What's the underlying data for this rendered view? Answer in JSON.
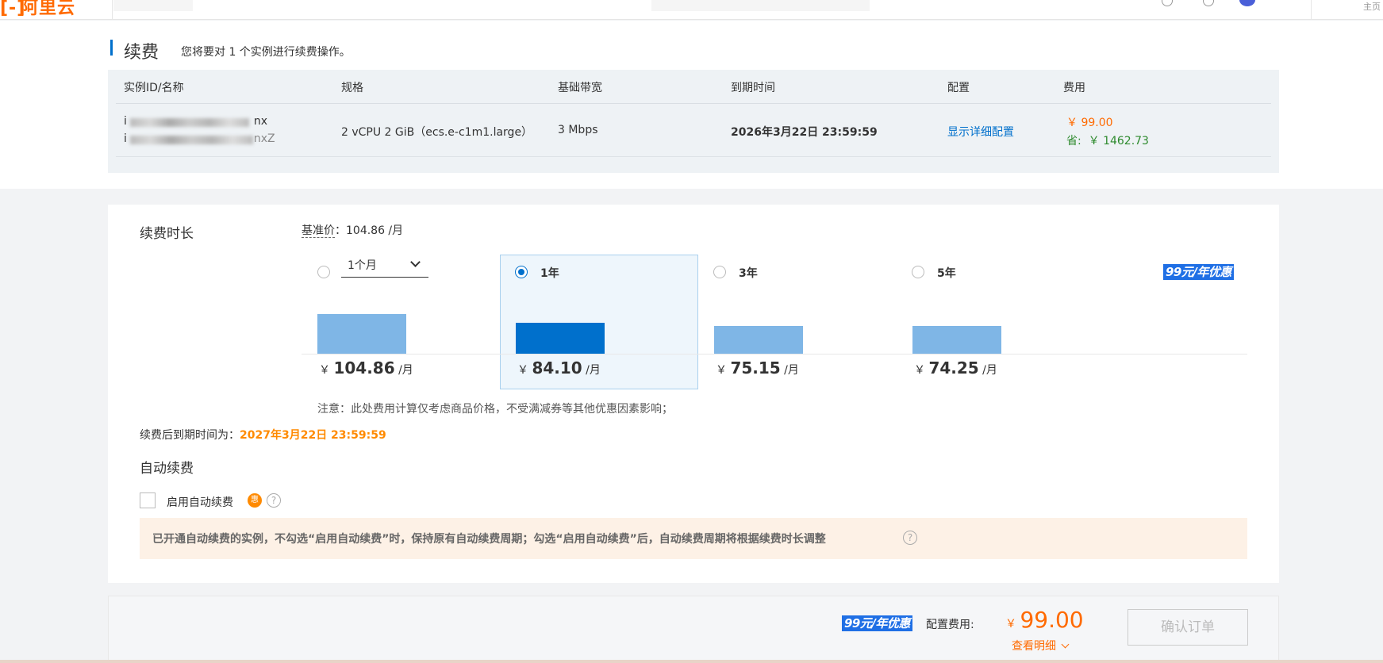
{
  "topbar": {
    "logo_text": "阿里云",
    "right_text": "主页"
  },
  "page": {
    "title": "续费",
    "subtitle": "您将要对 1 个实例进行续费操作。"
  },
  "instance_table": {
    "headers": [
      "实例ID/名称",
      "规格",
      "基础带宽",
      "到期时间",
      "配置",
      "费用"
    ],
    "row": {
      "id_suffix": "nx",
      "name_suffix": "nxZ",
      "spec": "2 vCPU 2 GiB（ecs.e-c1m1.large）",
      "bandwidth": "3 Mbps",
      "expire": "2026年3月22日 23:59:59",
      "config_link": "显示详细配置",
      "price": "￥ 99.00",
      "save_label": "省:",
      "save_amount": "￥ 1462.73"
    }
  },
  "renew": {
    "duration_label": "续费时长",
    "base_price_label": "基准价",
    "base_price_value": "：104.86 /月",
    "promo_badge": "99元/年优惠",
    "options": [
      {
        "label": "1个月",
        "currency": "￥",
        "price": "104.86",
        "unit": "/月",
        "selected": false,
        "bar_level": 0.49
      },
      {
        "label": "1年",
        "currency": "￥",
        "price": "84.10",
        "unit": "/月",
        "selected": true,
        "bar_level": 0.38
      },
      {
        "label": "3年",
        "currency": "￥",
        "price": "75.15",
        "unit": "/月",
        "selected": false,
        "bar_level": 0.34
      },
      {
        "label": "5年",
        "currency": "￥",
        "price": "74.25",
        "unit": "/月",
        "selected": false,
        "bar_level": 0.34
      }
    ],
    "note": "注意：此处费用计算仅考虑商品价格，不受满减券等其他优惠因素影响；",
    "expire_after_label": "续费后到期时间为：",
    "expire_after_value": "2027年3月22日 23:59:59"
  },
  "auto_renew": {
    "title": "自动续费",
    "checkbox_label": "启用自动续费",
    "badge": "惠",
    "help": "?",
    "tip": "已开通自动续费的实例，不勾选“启用自动续费”时，保持原有自动续费周期；勾选“启用自动续费”后，自动续费周期将根据续费时长调整"
  },
  "footer": {
    "promo_badge": "99元/年优惠",
    "config_fee_label": "配置费用:",
    "currency": "￥",
    "fee": "99.00",
    "detail_link": "查看明细",
    "confirm_button": "确认订单"
  },
  "colors": {
    "accent": "#0070cc",
    "orange": "#ff6a00",
    "promo": "#1f6fe5",
    "save_green": "#2d8a2d"
  }
}
